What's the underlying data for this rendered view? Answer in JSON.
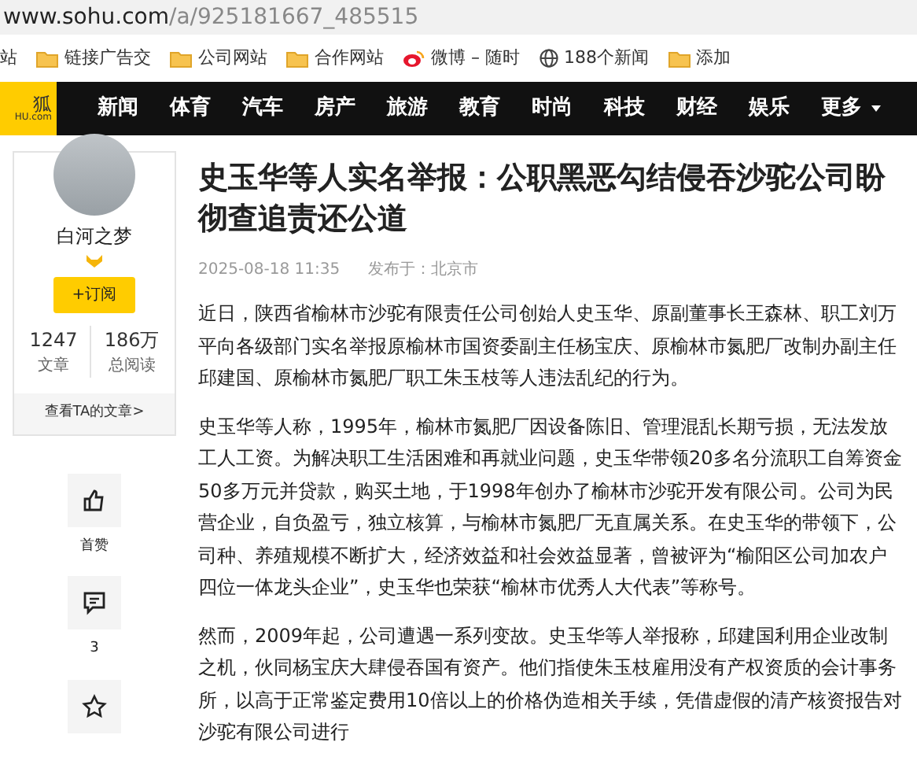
{
  "address_bar": {
    "host": "www.sohu.com",
    "path": "/a/925181667_485515"
  },
  "bookmarks": [
    {
      "kind": "text",
      "label": "站"
    },
    {
      "kind": "folder",
      "label": "链接广告交"
    },
    {
      "kind": "folder",
      "label": "公司网站"
    },
    {
      "kind": "folder",
      "label": "合作网站"
    },
    {
      "kind": "weibo",
      "label": "微博 – 随时"
    },
    {
      "kind": "globe",
      "label": "188个新闻"
    },
    {
      "kind": "folder",
      "label": "添加"
    }
  ],
  "logo": {
    "mark": "狐",
    "domain": "HU.com"
  },
  "nav": [
    {
      "label": "新闻",
      "dropdown": false
    },
    {
      "label": "体育",
      "dropdown": false
    },
    {
      "label": "汽车",
      "dropdown": false
    },
    {
      "label": "房产",
      "dropdown": false
    },
    {
      "label": "旅游",
      "dropdown": false
    },
    {
      "label": "教育",
      "dropdown": false
    },
    {
      "label": "时尚",
      "dropdown": false
    },
    {
      "label": "科技",
      "dropdown": false
    },
    {
      "label": "财经",
      "dropdown": false
    },
    {
      "label": "娱乐",
      "dropdown": false
    },
    {
      "label": "更多",
      "dropdown": true
    }
  ],
  "author": {
    "name": "白河之梦",
    "subscribe": "+订阅",
    "stats": [
      {
        "value": "1247",
        "label": "文章"
      },
      {
        "value": "186万",
        "label": "总阅读"
      }
    ],
    "more_link": "查看TA的文章>"
  },
  "actions": [
    {
      "kind": "like",
      "label": "首赞"
    },
    {
      "kind": "comment",
      "label": "3"
    },
    {
      "kind": "star"
    }
  ],
  "article": {
    "title": "史玉华等人实名举报：公职黑恶勾结侵吞沙驼公司盼彻查追责还公道",
    "date": "2025-08-18 11:35",
    "location": "发布于：北京市",
    "paragraphs": [
      "近日，陕西省榆林市沙驼有限责任公司创始人史玉华、原副董事长王森林、职工刘万平向各级部门实名举报原榆林市国资委副主任杨宝庆、原榆林市氮肥厂改制办副主任邱建国、原榆林市氮肥厂职工朱玉枝等人违法乱纪的行为。",
      "史玉华等人称，1995年，榆林市氮肥厂因设备陈旧、管理混乱长期亏损，无法发放工人工资。为解决职工生活困难和再就业问题，史玉华带领20多名分流职工自筹资金50多万元并贷款，购买土地，于1998年创办了榆林市沙驼开发有限公司。公司为民营企业，自负盈亏，独立核算，与榆林市氮肥厂无直属关系。在史玉华的带领下，公司种、养殖规模不断扩大，经济效益和社会效益显著，曾被评为“榆阳区公司加农户四位一体龙头企业”，史玉华也荣获“榆林市优秀人大代表”等称号。",
      "然而，2009年起，公司遭遇一系列变故。史玉华等人举报称，邱建国利用企业改制之机，伙同杨宝庆大肆侵吞国有资产。他们指使朱玉枝雇用没有产权资质的会计事务所，以高于正常鉴定费用10倍以上的价格伪造相关手续，凭借虚假的清产核资报告对沙驼有限公司进行"
    ]
  }
}
